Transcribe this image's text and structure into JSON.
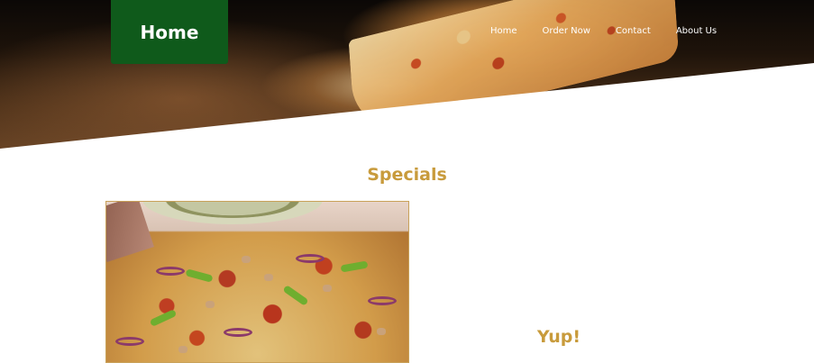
{
  "brand": {
    "home_label": "Home"
  },
  "nav": {
    "items": [
      {
        "label": "Home"
      },
      {
        "label": "Order Now"
      },
      {
        "label": "Contact"
      },
      {
        "label": "About Us"
      }
    ]
  },
  "specials": {
    "title": "Specials",
    "image_alt": "supreme pizza",
    "caption": "Yup!"
  },
  "colors": {
    "brand_green": "#0f5a1b",
    "accent_gold": "#c89b3c",
    "nav_text": "#ffffff"
  }
}
